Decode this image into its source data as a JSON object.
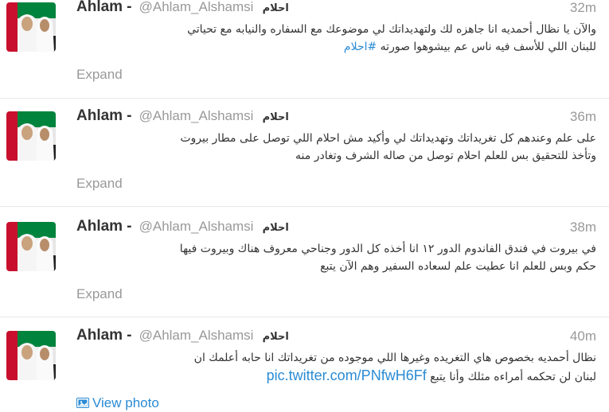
{
  "colors": {
    "link": "#2a8bd4",
    "muted": "#999999",
    "text": "#333333"
  },
  "tweets": [
    {
      "author": "Ahlam",
      "dash": "-",
      "handle": "@Ahlam_Alshamsi",
      "arabic_name": "احلام",
      "time": "32m",
      "lines": [
        "والآن يا نظال أحمديه انا جاهزه لك ولتهديداتك لي موضوعك مع السفاره والنيابه مع تحياتي",
        "للبنان اللي للأسف فيه ناس عم بيشوهوا صورته"
      ],
      "hashtag": "#احلام",
      "action": "Expand"
    },
    {
      "author": "Ahlam",
      "dash": "-",
      "handle": "@Ahlam_Alshamsi",
      "arabic_name": "احلام",
      "time": "36m",
      "lines": [
        "على علم وعندهم كل تغريداتك وتهديداتك لي وأكيد مش احلام اللي توصل على مطار بيروت",
        "وتأخذ للتحقيق بس للعلم احلام توصل من صاله الشرف وتغادر منه"
      ],
      "action": "Expand"
    },
    {
      "author": "Ahlam",
      "dash": "-",
      "handle": "@Ahlam_Alshamsi",
      "arabic_name": "احلام",
      "time": "38m",
      "lines": [
        "في بيروت في فندق الفاندوم الدور ١٢ انا أخذه كل الدور وجناحي معروف هناك وبيروت فيها",
        "حكم وبس للعلم انا عطيت علم لسعاده السفير وهم الآن يتبع"
      ],
      "action": "Expand"
    },
    {
      "author": "Ahlam",
      "dash": "-",
      "handle": "@Ahlam_Alshamsi",
      "arabic_name": "احلام",
      "time": "40m",
      "lines": [
        "نظال أحمديه بخصوص هاي التغريده وغيرها اللي موجوده من تغريداتك انا حابه أعلمك ان",
        "لبنان لن تحكمه أمراءه مثلك وأنا يتبع"
      ],
      "link": "pic.twitter.com/PNfwH6Ff",
      "action": "View photo",
      "action_icon": "photo-icon"
    }
  ]
}
